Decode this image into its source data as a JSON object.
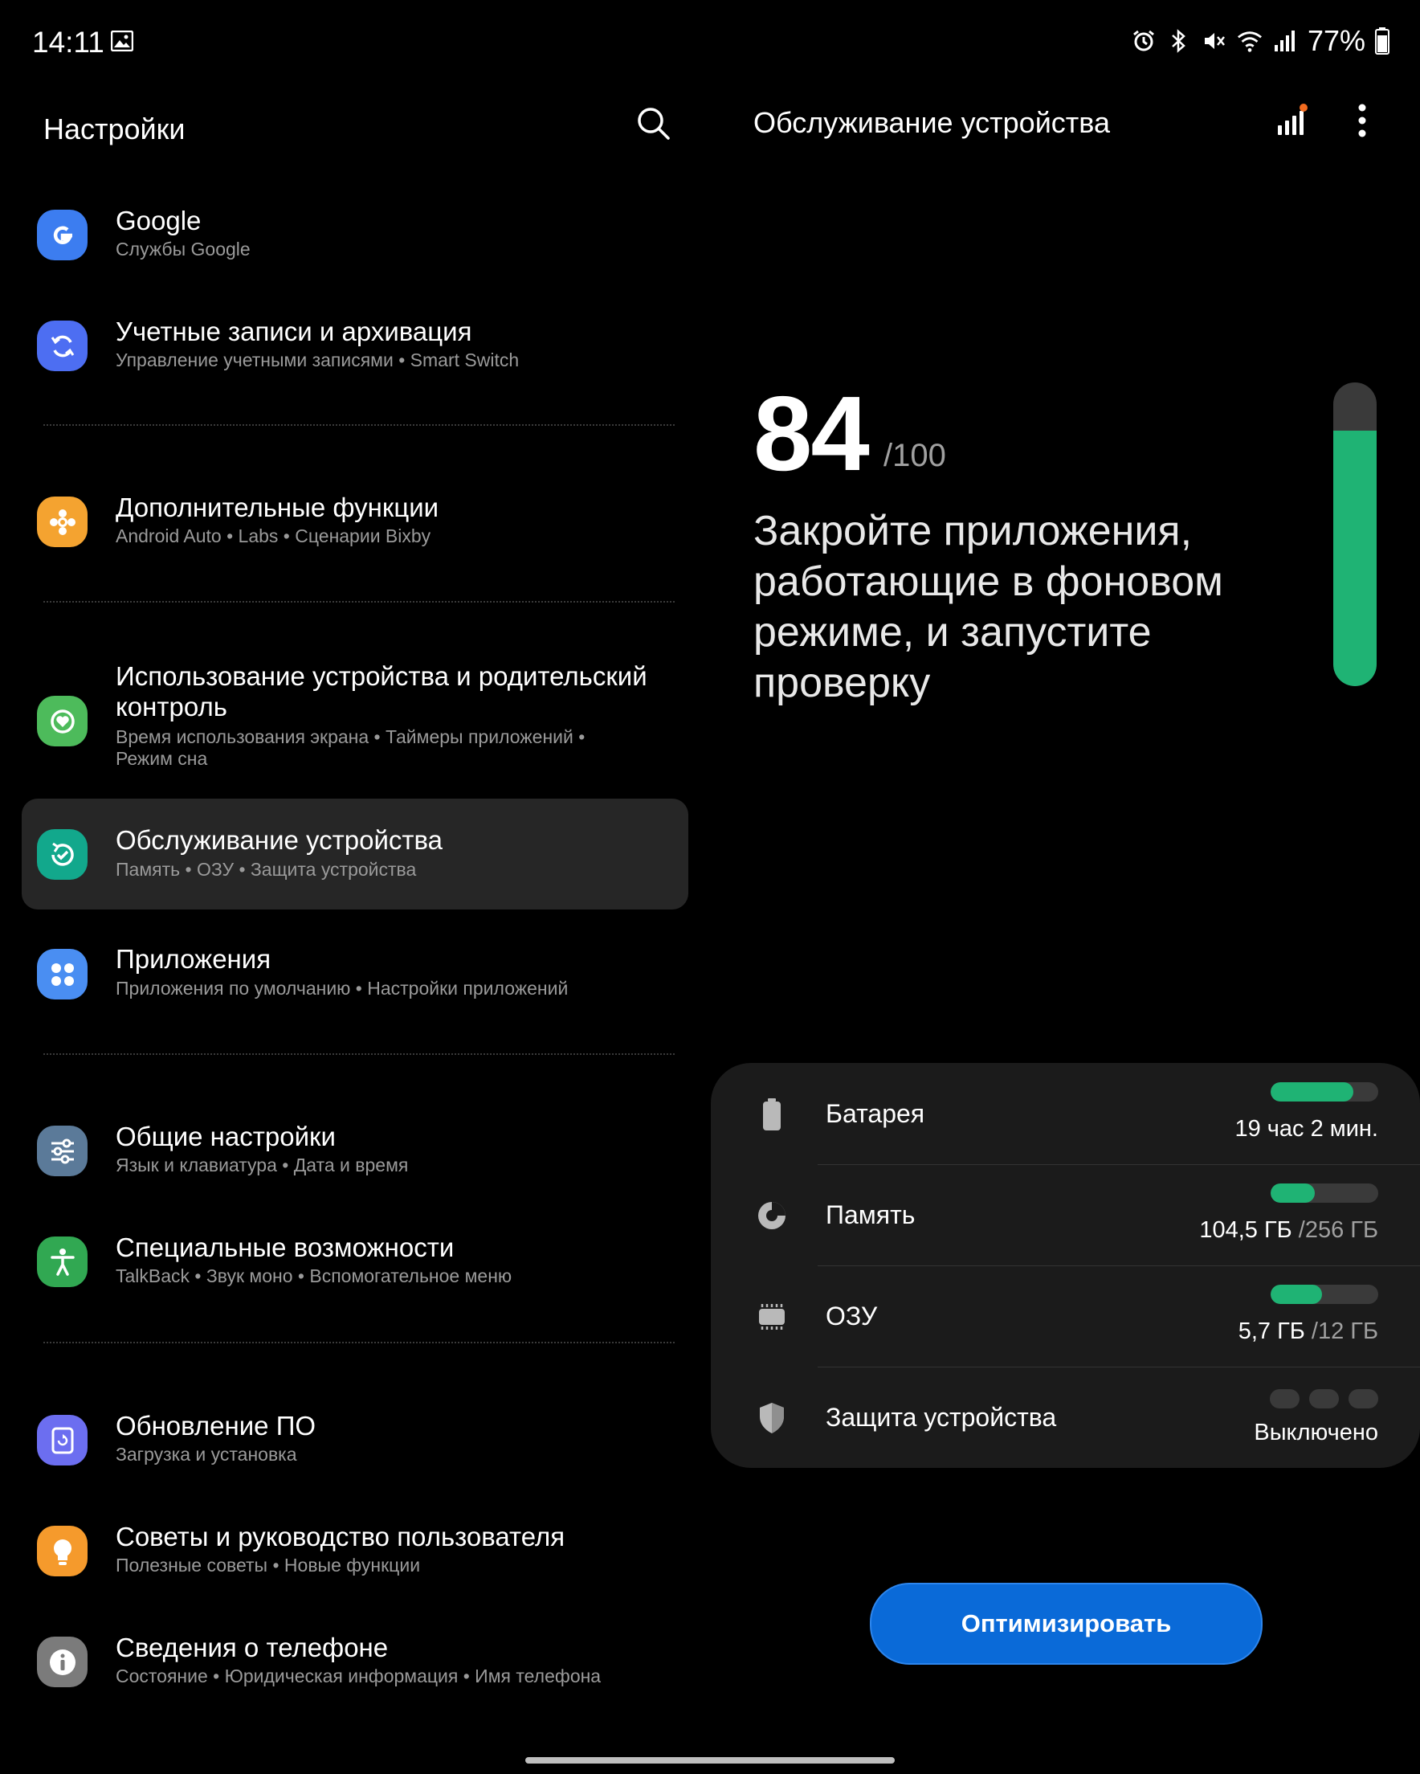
{
  "status_bar": {
    "time": "14:11",
    "battery": "77%",
    "icons": [
      "image-icon",
      "alarm-icon",
      "bluetooth-icon",
      "mute-icon",
      "wifi-icon",
      "signal-icon",
      "battery-icon"
    ]
  },
  "left_panel": {
    "title": "Настройки",
    "items": [
      {
        "title": "Google",
        "subtitle": "Службы Google",
        "icon": "google-icon",
        "color": "#3c7df0"
      },
      {
        "title": "Учетные записи и архивация",
        "subtitle": "Управление учетными записями  •  Smart Switch",
        "icon": "sync-icon",
        "color": "#4d6ef2"
      },
      {
        "title": "Дополнительные функции",
        "subtitle": "Android Auto  •  Labs  •  Сценарии Bixby",
        "icon": "puzzle-icon",
        "color": "#f4a330"
      },
      {
        "title": "Использование устройства и родительский",
        "title2": "контроль",
        "subtitle": "Время использования экрана  •  Таймеры приложений  •",
        "subtitle2": "Режим сна",
        "icon": "wellbeing-icon",
        "color": "#4dbb5b"
      },
      {
        "title": "Обслуживание устройства",
        "subtitle": "Память  •  ОЗУ  •  Защита устройства",
        "icon": "device-care-icon",
        "color": "#12a88c"
      },
      {
        "title": "Приложения",
        "subtitle": "Приложения по умолчанию  •  Настройки приложений",
        "icon": "apps-icon",
        "color": "#4a8ef2"
      },
      {
        "title": "Общие настройки",
        "subtitle": "Язык и клавиатура  •  Дата и время",
        "icon": "sliders-icon",
        "color": "#5b7a99"
      },
      {
        "title": "Специальные возможности",
        "subtitle": "TalkBack  •  Звук моно  •  Вспомогательное меню",
        "icon": "accessibility-icon",
        "color": "#31a852"
      },
      {
        "title": "Обновление ПО",
        "subtitle": "Загрузка и установка",
        "icon": "update-icon",
        "color": "#6c6ef0"
      },
      {
        "title": "Советы и руководство пользователя",
        "subtitle": "Полезные советы  •  Новые функции",
        "icon": "lightbulb-icon",
        "color": "#f59a2c"
      },
      {
        "title": "Сведения о телефоне",
        "subtitle": "Состояние  •  Юридическая информация  •  Имя телефона",
        "icon": "info-icon",
        "color": "#7b7b7b"
      }
    ]
  },
  "right_panel": {
    "title": "Обслуживание устройства",
    "score": "84",
    "score_max": "/100",
    "score_fraction": 0.84,
    "message": "Закройте приложения, работающие в фоновом режиме, и запустите проверку",
    "rows": [
      {
        "label": "Батарея",
        "value": "19 час 2 мин.",
        "value_muted": "",
        "fill": 0.77
      },
      {
        "label": "Память",
        "value": "104,5 ГБ",
        "value_muted": " /256 ГБ",
        "fill": 0.41
      },
      {
        "label": "ОЗУ",
        "value": "5,7 ГБ",
        "value_muted": " /12 ГБ",
        "fill": 0.475
      },
      {
        "label": "Защита устройства",
        "value": "Выключено",
        "value_muted": ""
      }
    ],
    "optimize_label": "Оптимизировать",
    "accent_color": "#1fb374",
    "button_color": "#0a6ad8"
  }
}
